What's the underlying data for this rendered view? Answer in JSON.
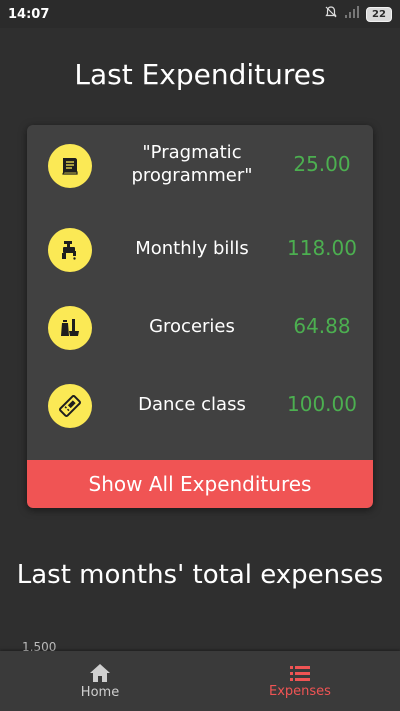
{
  "status_bar": {
    "time": "14:07",
    "battery": "22",
    "icons": [
      "notification-off-icon",
      "signal-icon",
      "battery-icon"
    ]
  },
  "title": "Last Expenditures",
  "expenditures": [
    {
      "name": "\"Pragmatic programmer\"",
      "amount": "25.00",
      "icon": "book-icon"
    },
    {
      "name": "Monthly bills",
      "amount": "118.00",
      "icon": "faucet-icon"
    },
    {
      "name": "Groceries",
      "amount": "64.88",
      "icon": "groceries-icon"
    },
    {
      "name": "Dance class",
      "amount": "100.00",
      "icon": "ticket-icon"
    }
  ],
  "show_all_label": "Show All Expenditures",
  "section_title": "Last months' total expenses",
  "chart_partial_label": "1,500",
  "bottom_nav": {
    "items": [
      {
        "label": "Home",
        "icon": "home-icon",
        "active": false
      },
      {
        "label": "Expenses",
        "icon": "list-icon",
        "active": true
      }
    ]
  },
  "colors": {
    "background": "#2f2f2f",
    "card": "#414141",
    "accent": "#f05454",
    "amount": "#4caf50",
    "icon_bg": "#fbe955"
  }
}
